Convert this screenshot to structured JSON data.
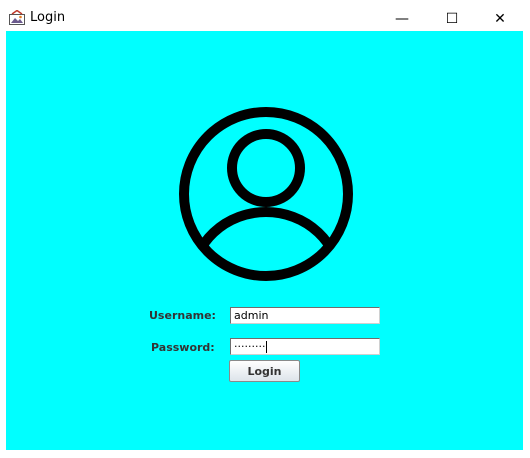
{
  "window": {
    "title": "Login",
    "icon": "java-app-icon",
    "controls": {
      "minimize_glyph": "—",
      "maximize_glyph": "☐",
      "close_glyph": "✕"
    }
  },
  "colors": {
    "background": "#00ffff",
    "avatar_stroke": "#000000"
  },
  "avatar": {
    "icon": "user-profile-icon"
  },
  "form": {
    "username_label": "Username:",
    "username_value": "admin",
    "password_label": "Password:",
    "password_value": "·········",
    "login_label": "Login"
  }
}
